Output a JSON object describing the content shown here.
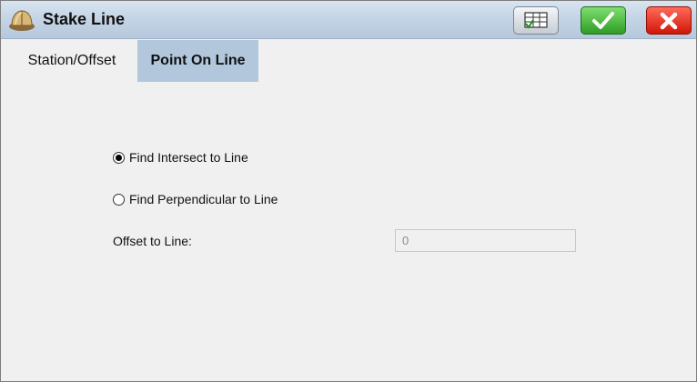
{
  "window": {
    "title": "Stake Line",
    "icons": {
      "app": "hard-hat-icon",
      "table": "table-check-icon",
      "ok": "checkmark-icon",
      "close": "close-x-icon"
    }
  },
  "tabs": [
    {
      "label": "Station/Offset",
      "active": false
    },
    {
      "label": "Point On Line",
      "active": true
    }
  ],
  "form": {
    "options": [
      {
        "label": "Find Intersect to Line",
        "selected": true
      },
      {
        "label": "Find Perpendicular to Line",
        "selected": false
      }
    ],
    "offset": {
      "label": "Offset to Line:",
      "value": "0"
    }
  },
  "colors": {
    "titlebar": "#c5d5e6",
    "active_tab": "#b2c7dc",
    "ok_green": "#2e9c25",
    "close_red": "#d11607",
    "background": "#f0f0f0"
  }
}
